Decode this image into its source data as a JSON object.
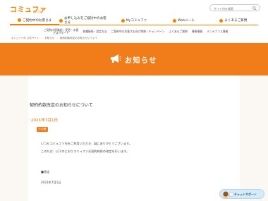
{
  "header": {
    "logo_main": "コミュファ",
    "logo_sub": "by ctc",
    "search_placeholder": "サイト内を検索"
  },
  "nav_main": [
    {
      "label": "ご契約中のお客さま"
    },
    {
      "label": "お申し込みをご検討中のお客さま"
    },
    {
      "label": "Myコミュファ"
    },
    {
      "label": "Webメール"
    },
    {
      "label": "よくあるご質問"
    }
  ],
  "nav_sub": [
    {
      "label": "ご契約内容確認・変更・お客\nさまサポート"
    },
    {
      "label": "各種接続・設定方法"
    },
    {
      "label": "ご契約中のお客さま向け特典・キャンペーン"
    },
    {
      "label": "よくあるご質問"
    },
    {
      "label": "障害情報"
    },
    {
      "label": "メンテナンス情報"
    }
  ],
  "breadcrumb": [
    "コミュファ光 公式サイト",
    "お知らせ",
    "契約約款改定のお知らせについて"
  ],
  "banner": {
    "title": "お知らせ"
  },
  "article": {
    "title": "契約約款改定のお知らせについて",
    "date": "2021年7月1日",
    "tag": "その他",
    "paragraphs": [
      "いつもコミュファ光をご利用いただき、誠にありがとうございます。",
      "このたび、以下のとおりコミュファ光契約約款の改定を行います。",
      "■改定",
      "2021年7月1日"
    ]
  },
  "support": {
    "label": "チャットサポート"
  },
  "colors": {
    "brand": "#f07d19",
    "banner": "#f07d19"
  }
}
